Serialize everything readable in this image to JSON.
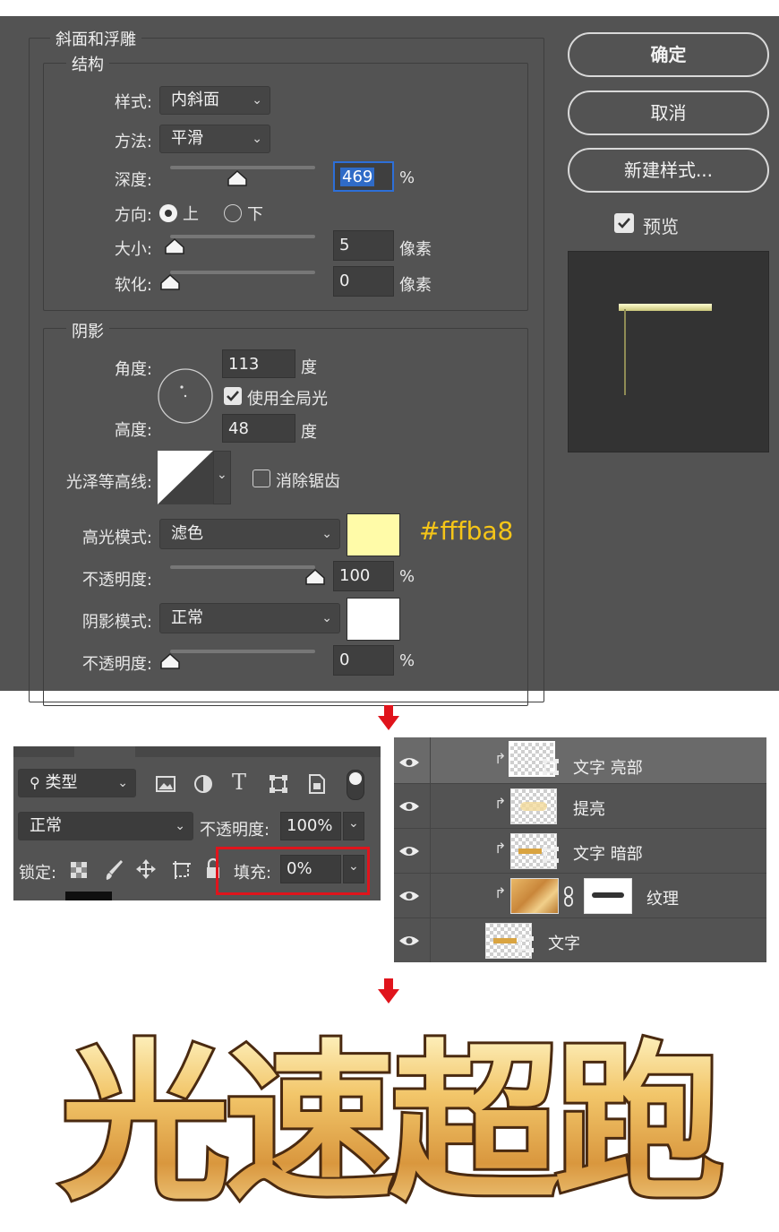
{
  "dialog": {
    "section_title": "斜面和浮雕",
    "structure": {
      "legend": "结构",
      "style_label": "样式:",
      "style_value": "内斜面",
      "technique_label": "方法:",
      "technique_value": "平滑",
      "depth_label": "深度:",
      "depth_value": "469",
      "depth_unit": "%",
      "depth_fraction": 0.46,
      "direction_label": "方向:",
      "direction_up": "上",
      "direction_down": "下",
      "direction_selected": "上",
      "size_label": "大小:",
      "size_value": "5",
      "size_unit": "像素",
      "size_fraction": 0.03,
      "soften_label": "软化:",
      "soften_value": "0",
      "soften_unit": "像素",
      "soften_fraction": 0.0
    },
    "shading": {
      "legend": "阴影",
      "angle_label": "角度:",
      "angle_value": "113",
      "angle_unit": "度",
      "global_light_label": "使用全局光",
      "global_light_checked": true,
      "altitude_label": "高度:",
      "altitude_value": "48",
      "altitude_unit": "度",
      "gloss_contour_label": "光泽等高线:",
      "anti_alias_label": "消除锯齿",
      "anti_alias_checked": false,
      "highlight_mode_label": "高光模式:",
      "highlight_mode_value": "滤色",
      "highlight_color": "#fffba8",
      "highlight_color_note": "#fffba8",
      "highlight_opacity_label": "不透明度:",
      "highlight_opacity_value": "100",
      "highlight_opacity_unit": "%",
      "highlight_opacity_fraction": 1.0,
      "shadow_mode_label": "阴影模式:",
      "shadow_mode_value": "正常",
      "shadow_color": "#ffffff",
      "shadow_opacity_label": "不透明度:",
      "shadow_opacity_value": "0",
      "shadow_opacity_unit": "%",
      "shadow_opacity_fraction": 0.0
    },
    "buttons": {
      "ok": "确定",
      "cancel": "取消",
      "new_style": "新建样式...",
      "preview_label": "预览",
      "preview_checked": true
    }
  },
  "layer_options": {
    "filter_label": "类型",
    "blend_mode": "正常",
    "opacity_label": "不透明度:",
    "opacity_value": "100%",
    "lock_label": "锁定:",
    "fill_label": "填充:",
    "fill_value": "0%"
  },
  "layers": [
    {
      "name": "文字 亮部",
      "clipped": true,
      "selected": true
    },
    {
      "name": "提亮",
      "clipped": true,
      "selected": false
    },
    {
      "name": "文字 暗部",
      "clipped": true,
      "selected": false
    },
    {
      "name": "纹理",
      "clipped": true,
      "selected": false,
      "has_mask": true
    },
    {
      "name": "文字",
      "clipped": false,
      "selected": false
    }
  ],
  "artwork": {
    "text": "光速超跑"
  },
  "colors": {
    "panel": "#535353",
    "arrow": "#e0141c",
    "highlight_box": "#e0141c"
  }
}
